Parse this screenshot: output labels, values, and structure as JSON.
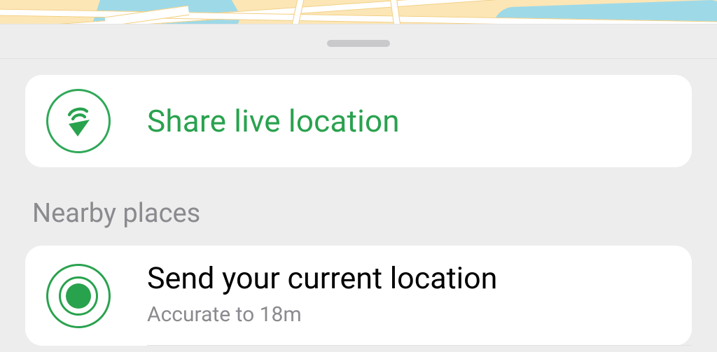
{
  "share_live": {
    "label": "Share live location",
    "icon": "live-location-icon"
  },
  "nearby": {
    "section_title": "Nearby places"
  },
  "send_current": {
    "title": "Send your current location",
    "accuracy": "Accurate to 18m",
    "icon": "current-location-icon"
  },
  "colors": {
    "accent": "#29A24E",
    "muted": "#8A8A8F",
    "sheet_bg": "#EDEDED",
    "card_bg": "#FFFFFF",
    "grabber": "#C9C9CC"
  }
}
